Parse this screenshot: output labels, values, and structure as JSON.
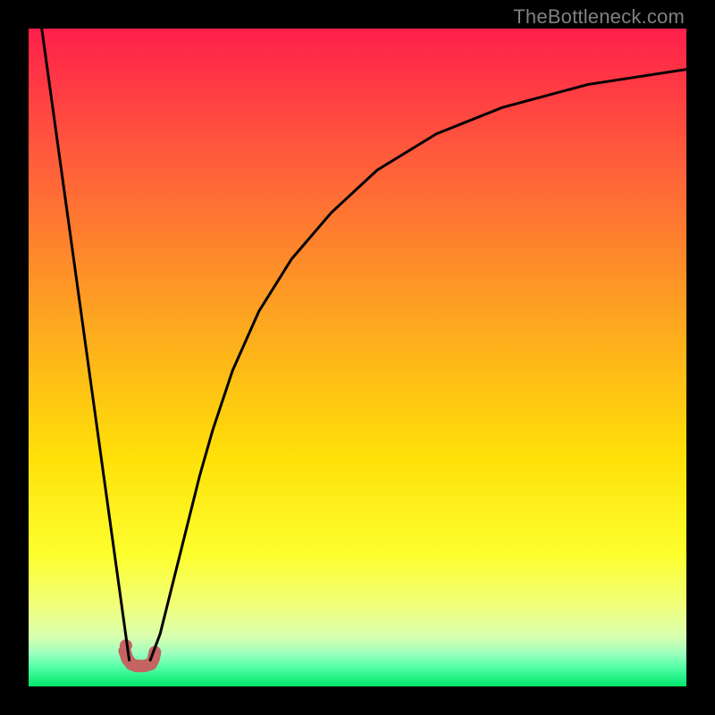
{
  "watermark": "TheBottleneck.com",
  "chart_data": {
    "type": "line",
    "title": "",
    "xlabel": "",
    "ylabel": "",
    "xlim": [
      0,
      100
    ],
    "ylim": [
      0,
      100
    ],
    "gradient_stops": [
      {
        "offset": 0,
        "color": "#ff1f4b"
      },
      {
        "offset": 20,
        "color": "#ff5d3b"
      },
      {
        "offset": 45,
        "color": "#fda81f"
      },
      {
        "offset": 65,
        "color": "#ffe008"
      },
      {
        "offset": 80,
        "color": "#fdff2f"
      },
      {
        "offset": 88,
        "color": "#f0ff7d"
      },
      {
        "offset": 92.5,
        "color": "#d8ffb0"
      },
      {
        "offset": 95,
        "color": "#9dffbf"
      },
      {
        "offset": 97,
        "color": "#56ffa8"
      },
      {
        "offset": 100,
        "color": "#00e66b"
      }
    ],
    "series": [
      {
        "name": "left-line",
        "x": [
          2,
          15.3
        ],
        "values": [
          100,
          4
        ],
        "stroke": "#000000",
        "stroke_width": 3
      },
      {
        "name": "right-curve",
        "x": [
          18.5,
          20,
          22,
          24,
          26,
          28,
          31,
          35,
          40,
          46,
          53,
          62,
          72,
          85,
          100
        ],
        "values": [
          4,
          8,
          16,
          24,
          32,
          39,
          48,
          57,
          65,
          72,
          78.5,
          84,
          88,
          91.5,
          93.8
        ],
        "stroke": "#000000",
        "stroke_width": 3
      }
    ],
    "trough_segment": {
      "x": [
        14.6,
        15.0,
        15.6,
        16.4,
        17.6,
        18.6,
        19.0,
        19.2
      ],
      "values": [
        5.4,
        4.2,
        3.4,
        3.1,
        3.1,
        3.4,
        4.2,
        5.2
      ],
      "stroke": "#c56461",
      "stroke_width": 14
    },
    "trough_marker": {
      "x": 14.8,
      "y": 6.2,
      "r_percent": 0.95,
      "fill": "#c56461"
    }
  }
}
